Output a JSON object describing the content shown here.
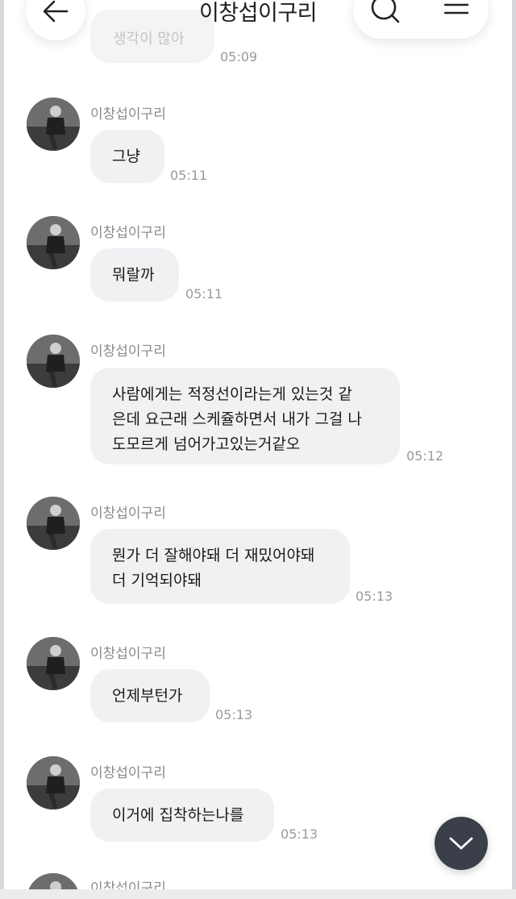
{
  "header": {
    "title": "이창섭이구리"
  },
  "top_fragment": {
    "text": "생각이 많아",
    "time": "05:09"
  },
  "messages": [
    {
      "sender": "이창섭이구리",
      "lines": [
        "그냥"
      ],
      "time": "05:11"
    },
    {
      "sender": "이창섭이구리",
      "lines": [
        "뭐랄까"
      ],
      "time": "05:11"
    },
    {
      "sender": "이창섭이구리",
      "lines": [
        "사람에게는 적정선이라는게 있는것 같",
        "은데 요근래 스케쥴하면서 내가 그걸 나",
        "도모르게 넘어가고있는거같오"
      ],
      "time": "05:12"
    },
    {
      "sender": "이창섭이구리",
      "lines": [
        "뭔가 더 잘해야돼 더 재밌어야돼",
        "더 기억되야돼"
      ],
      "time": "05:13"
    },
    {
      "sender": "이창섭이구리",
      "lines": [
        "언제부턴가"
      ],
      "time": "05:13"
    },
    {
      "sender": "이창섭이구리",
      "lines": [
        "이거에 집착하는나를"
      ],
      "time": "05:13"
    }
  ],
  "cut_sender": "이창섭이구리",
  "icons": {
    "back": "arrow-left-icon",
    "search": "search-icon",
    "menu": "menu-icon",
    "scroll": "chevron-down-icon"
  },
  "colors": {
    "bubble": "#f1f1f4",
    "scroll_button": "#3b3f4a"
  }
}
